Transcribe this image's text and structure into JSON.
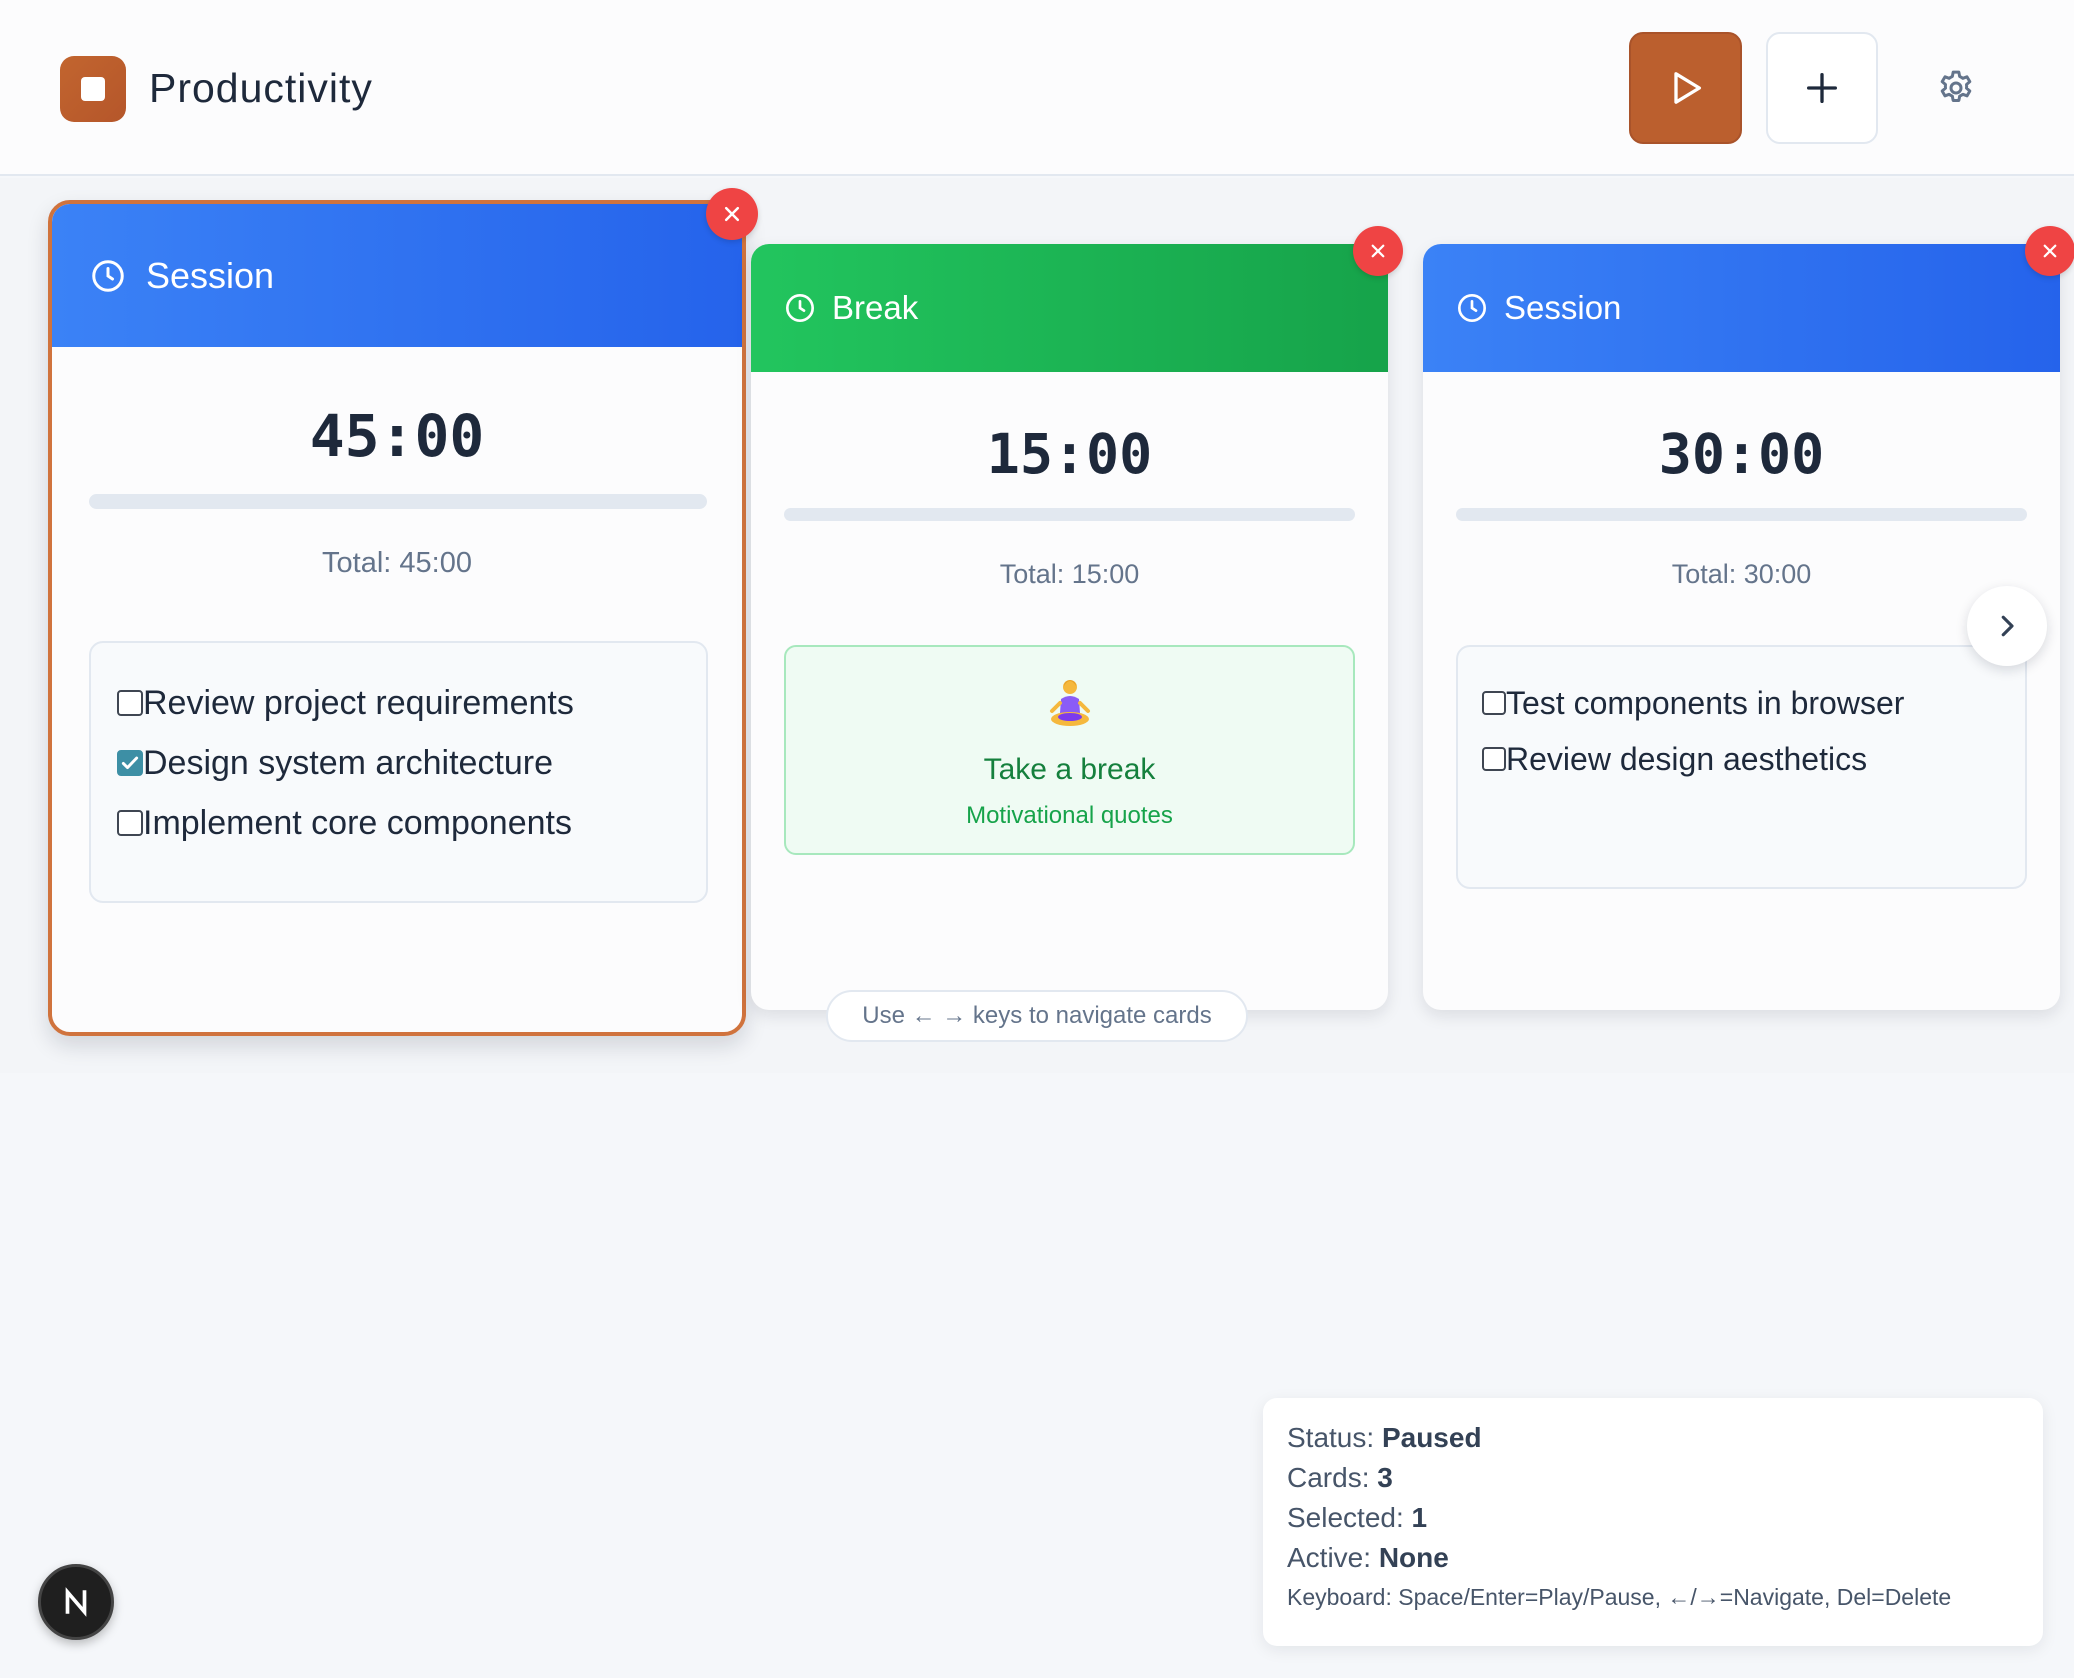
{
  "header": {
    "app_title": "Productivity",
    "accent_color": "#bb5f2e",
    "buttons": {
      "play_icon": "play-icon",
      "add_icon": "plus-icon",
      "settings_icon": "gear-icon"
    }
  },
  "cards": [
    {
      "type": "Session",
      "header_color": "#2563eb",
      "selected": true,
      "timer": "45:00",
      "progress": 0,
      "total": "Total: 45:00",
      "tasks": [
        {
          "label": "Review project requirements",
          "checked": false
        },
        {
          "label": "Design system architecture",
          "checked": true
        },
        {
          "label": "Implement core components",
          "checked": false
        }
      ]
    },
    {
      "type": "Break",
      "header_color": "#16a34a",
      "selected": false,
      "timer": "15:00",
      "progress": 0,
      "total": "Total: 15:00",
      "break_title": "Take a break",
      "break_subtitle": "Motivational quotes",
      "break_icon": "meditating-person-icon"
    },
    {
      "type": "Session",
      "header_color": "#2563eb",
      "selected": false,
      "timer": "30:00",
      "progress": 0,
      "total": "Total: 30:00",
      "tasks": [
        {
          "label": "Test components in browser",
          "checked": false
        },
        {
          "label": "Review design aesthetics",
          "checked": false
        }
      ]
    }
  ],
  "hint": "Use ← → keys to navigate cards",
  "status_panel": {
    "status_label": "Status:",
    "status_value": "Paused",
    "cards_label": "Cards:",
    "cards_value": "3",
    "selected_label": "Selected:",
    "selected_value": "1",
    "active_label": "Active:",
    "active_value": "None",
    "keyboard": "Keyboard: Space/Enter=Play/Pause, ←/→=Navigate, Del=Delete"
  },
  "dev_badge": "N"
}
